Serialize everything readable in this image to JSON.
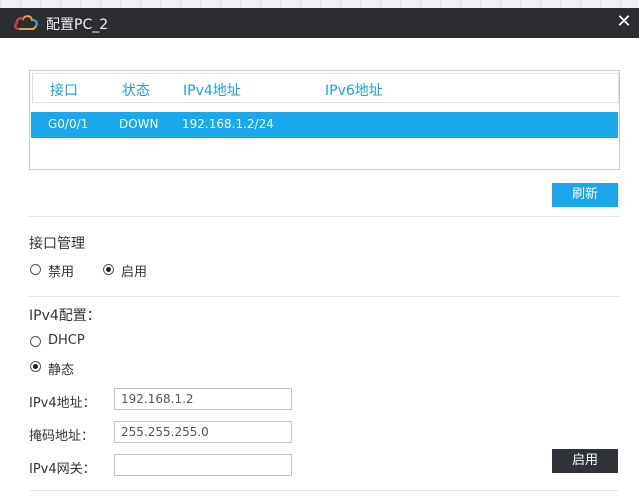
{
  "window": {
    "title": "配置PC_2",
    "close_glyph": "✕"
  },
  "table": {
    "headers": [
      "接口",
      "状态",
      "IPv4地址",
      "IPv6地址"
    ],
    "rows": [
      {
        "interface": "G0/0/1",
        "status": "DOWN",
        "ipv4": "192.168.1.2/24",
        "ipv6": ""
      }
    ]
  },
  "refresh_button": "刷新",
  "interface_mgmt": {
    "title": "接口管理",
    "options": [
      {
        "label": "禁用",
        "checked": false
      },
      {
        "label": "启用",
        "checked": true
      }
    ]
  },
  "ipv4": {
    "title": "IPv4配置：",
    "modes": [
      {
        "label": "DHCP",
        "checked": false
      },
      {
        "label": "静态",
        "checked": true
      }
    ],
    "fields": [
      {
        "label": "IPv4地址：",
        "value": "192.168.1.2"
      },
      {
        "label": "掩码地址：",
        "value": "255.255.255.0"
      },
      {
        "label": "IPv4网关：",
        "value": ""
      }
    ]
  },
  "apply_button": "启用",
  "colors": {
    "accent": "#1aa7ec",
    "titlebar": "#2b2d30",
    "header_text": "#1aa3dd"
  },
  "icons": {
    "app": "cloud-icon",
    "close": "close-icon"
  }
}
